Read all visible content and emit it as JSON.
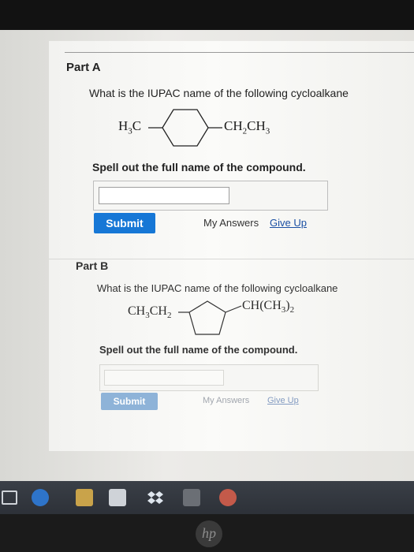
{
  "partA": {
    "title": "Part A",
    "question": "What is the IUPAC name of the following cycloalkane",
    "substituent_left": {
      "main": "H",
      "sub": "3",
      "tail": "C"
    },
    "substituent_right": {
      "main": "CH",
      "sub1": "2",
      "mid": "CH",
      "sub2": "3"
    },
    "instruction": "Spell out the full name of the compound.",
    "answer_value": "",
    "submit_label": "Submit",
    "my_answers_label": "My Answers",
    "give_up_label": "Give Up"
  },
  "partB": {
    "title": "Part B",
    "question": "What is the IUPAC name of the following cycloalkane",
    "substituent_left": {
      "main": "CH",
      "sub1": "3",
      "mid": "CH",
      "sub2": "2"
    },
    "substituent_right": {
      "main": "CH(CH",
      "sub1": "3",
      "tail": ")",
      "sub2": "2"
    },
    "instruction": "Spell out the full name of the compound.",
    "answer_value": "",
    "submit_label": "Submit",
    "my_answers_label": "My Answers",
    "give_up_label": "Give Up"
  },
  "colors": {
    "submit_blue": "#1677d6",
    "link_blue": "#1a4fa3",
    "taskbar": "#2d3138"
  },
  "taskbar_icons": [
    "windows-start-icon",
    "edge-icon",
    "file-explorer-icon",
    "store-icon",
    "dropbox-icon",
    "app-icon",
    "chrome-icon"
  ],
  "device_logo": "hp"
}
